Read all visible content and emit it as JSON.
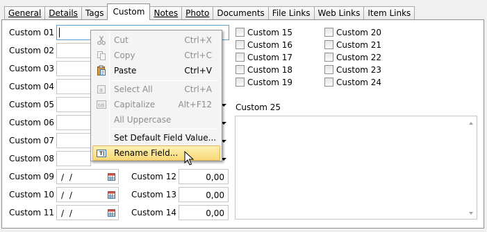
{
  "tabs": [
    {
      "label": "General",
      "underline": true
    },
    {
      "label": "Details",
      "underline": true
    },
    {
      "label": "Tags",
      "underline": false
    },
    {
      "label": "Custom",
      "underline": false,
      "active": true
    },
    {
      "label": "Notes",
      "underline": true
    },
    {
      "label": "Photo",
      "underline": true
    },
    {
      "label": "Documents",
      "underline": false
    },
    {
      "label": "File Links",
      "underline": false
    },
    {
      "label": "Web Links",
      "underline": false
    },
    {
      "label": "Item Links",
      "underline": false
    }
  ],
  "fields_left": {
    "c01": "Custom 01",
    "c02": "Custom 02",
    "c03": "Custom 03",
    "c04": "Custom 04",
    "c05": "Custom 05",
    "c06": "Custom 06",
    "c07": "Custom 07",
    "c08": "Custom 08",
    "c09": "Custom 09",
    "c10": "Custom 10",
    "c11": "Custom 11"
  },
  "date_value": "/ /",
  "fields_num": {
    "c12": "Custom 12",
    "c13": "Custom 13",
    "c14": "Custom 14",
    "v12": "0,00",
    "v13": "0,00",
    "v14": "0,00"
  },
  "checkboxes": {
    "c15": "Custom 15",
    "c16": "Custom 16",
    "c17": "Custom 17",
    "c18": "Custom 18",
    "c19": "Custom 19",
    "c20": "Custom 20",
    "c21": "Custom 21",
    "c22": "Custom 22",
    "c23": "Custom 23",
    "c24": "Custom 24"
  },
  "memo_label": "Custom 25",
  "context_menu": {
    "cut": {
      "label": "Cut",
      "shortcut": "Ctrl+X"
    },
    "copy": {
      "label": "Copy",
      "shortcut": "Ctrl+C"
    },
    "paste": {
      "label": "Paste",
      "shortcut": "Ctrl+V"
    },
    "select_all": {
      "label": "Select All",
      "shortcut": "Ctrl+A"
    },
    "capitalize": {
      "label": "Capitalize",
      "shortcut": "Alt+F12"
    },
    "all_uppercase": {
      "label": "All Uppercase"
    },
    "set_default": {
      "label": "Set Default Field Value..."
    },
    "rename": {
      "label": "Rename Field..."
    }
  },
  "colors": {
    "highlight": "#f8d977",
    "focus_border": "#5a9fd4",
    "disabled_text": "#8d8d8d"
  }
}
